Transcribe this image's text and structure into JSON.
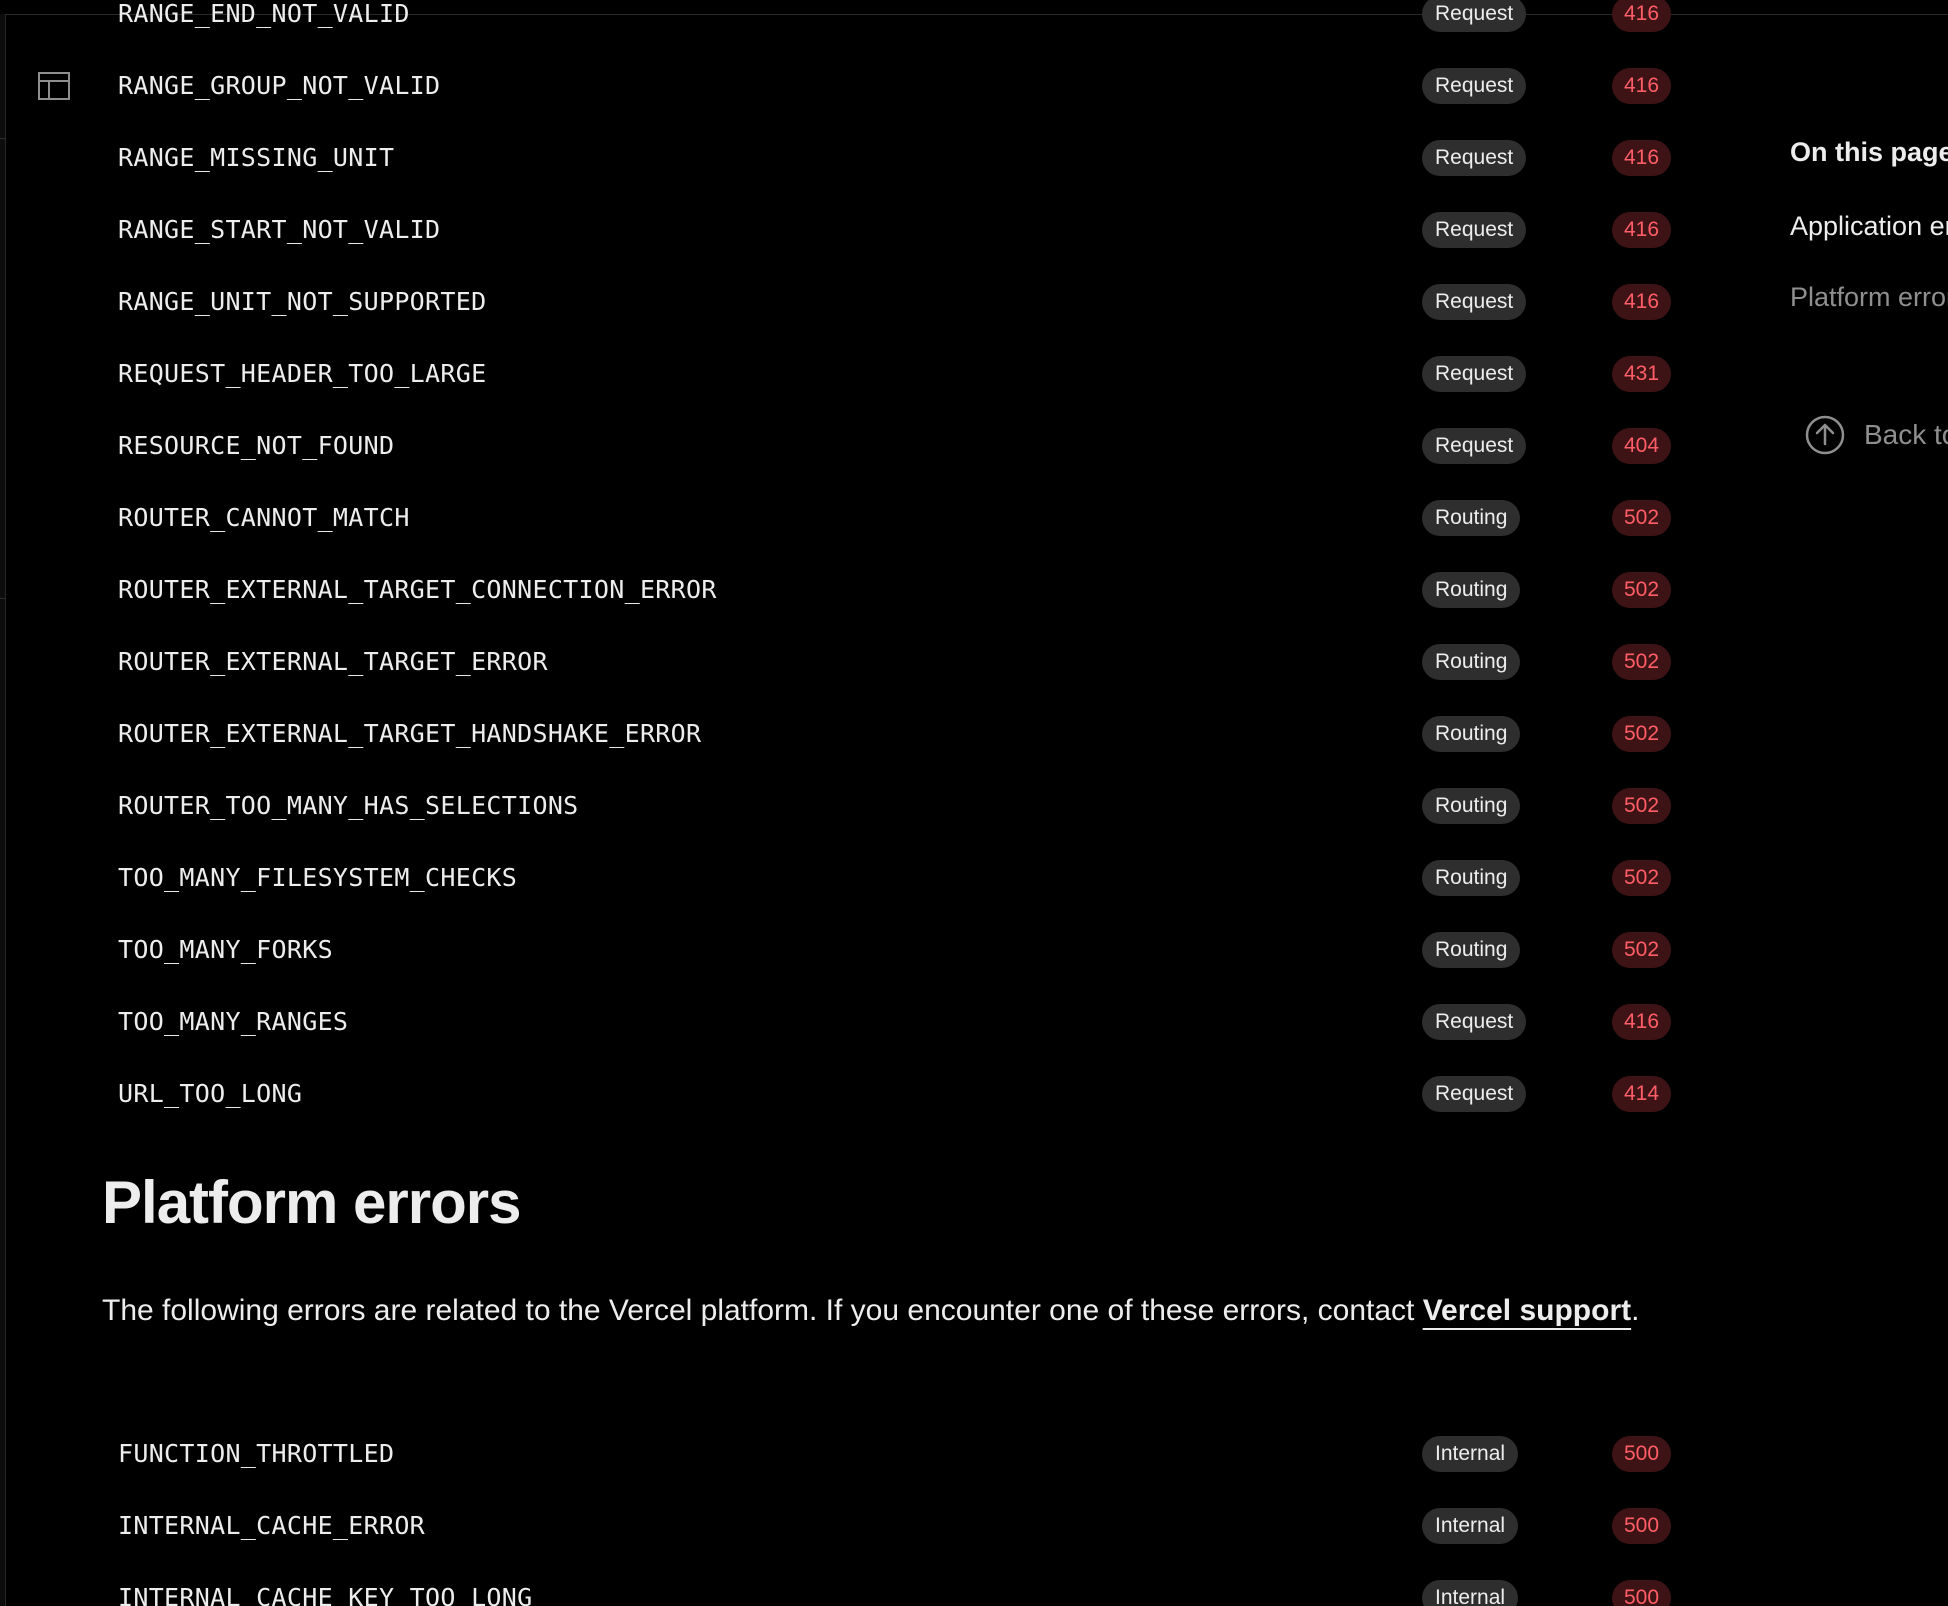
{
  "sidebar": {
    "toggle_icon": "sidebar-layout-icon"
  },
  "colors": {
    "background": "#000000",
    "text": "#ededed",
    "muted_text": "#8f8f8f",
    "category_badge_bg": "#2e2e2e",
    "status_badge_bg": "#3d1316",
    "status_badge_text": "#ff5e66"
  },
  "application_errors": {
    "rows": [
      {
        "code": "RANGE_END_NOT_VALID",
        "category": "Request",
        "status": "416"
      },
      {
        "code": "RANGE_GROUP_NOT_VALID",
        "category": "Request",
        "status": "416"
      },
      {
        "code": "RANGE_MISSING_UNIT",
        "category": "Request",
        "status": "416"
      },
      {
        "code": "RANGE_START_NOT_VALID",
        "category": "Request",
        "status": "416"
      },
      {
        "code": "RANGE_UNIT_NOT_SUPPORTED",
        "category": "Request",
        "status": "416"
      },
      {
        "code": "REQUEST_HEADER_TOO_LARGE",
        "category": "Request",
        "status": "431"
      },
      {
        "code": "RESOURCE_NOT_FOUND",
        "category": "Request",
        "status": "404"
      },
      {
        "code": "ROUTER_CANNOT_MATCH",
        "category": "Routing",
        "status": "502"
      },
      {
        "code": "ROUTER_EXTERNAL_TARGET_CONNECTION_ERROR",
        "category": "Routing",
        "status": "502"
      },
      {
        "code": "ROUTER_EXTERNAL_TARGET_ERROR",
        "category": "Routing",
        "status": "502"
      },
      {
        "code": "ROUTER_EXTERNAL_TARGET_HANDSHAKE_ERROR",
        "category": "Routing",
        "status": "502"
      },
      {
        "code": "ROUTER_TOO_MANY_HAS_SELECTIONS",
        "category": "Routing",
        "status": "502"
      },
      {
        "code": "TOO_MANY_FILESYSTEM_CHECKS",
        "category": "Routing",
        "status": "502"
      },
      {
        "code": "TOO_MANY_FORKS",
        "category": "Routing",
        "status": "502"
      },
      {
        "code": "TOO_MANY_RANGES",
        "category": "Request",
        "status": "416"
      },
      {
        "code": "URL_TOO_LONG",
        "category": "Request",
        "status": "414"
      }
    ]
  },
  "platform_errors": {
    "heading": "Platform errors",
    "intro_text": "The following errors are related to the Vercel platform. If you encounter one of these errors, contact ",
    "intro_link": "Vercel support",
    "intro_end": ".",
    "rows": [
      {
        "code": "FUNCTION_THROTTLED",
        "category": "Internal",
        "status": "500"
      },
      {
        "code": "INTERNAL_CACHE_ERROR",
        "category": "Internal",
        "status": "500"
      },
      {
        "code": "INTERNAL_CACHE_KEY_TOO_LONG",
        "category": "Internal",
        "status": "500"
      }
    ]
  },
  "toc": {
    "title": "On this page",
    "items": [
      {
        "label": "Application errors",
        "active": true
      },
      {
        "label": "Platform errors",
        "active": false
      }
    ],
    "back_to_top": "Back to top",
    "back_to_top_icon": "arrow-up-circle-icon"
  }
}
